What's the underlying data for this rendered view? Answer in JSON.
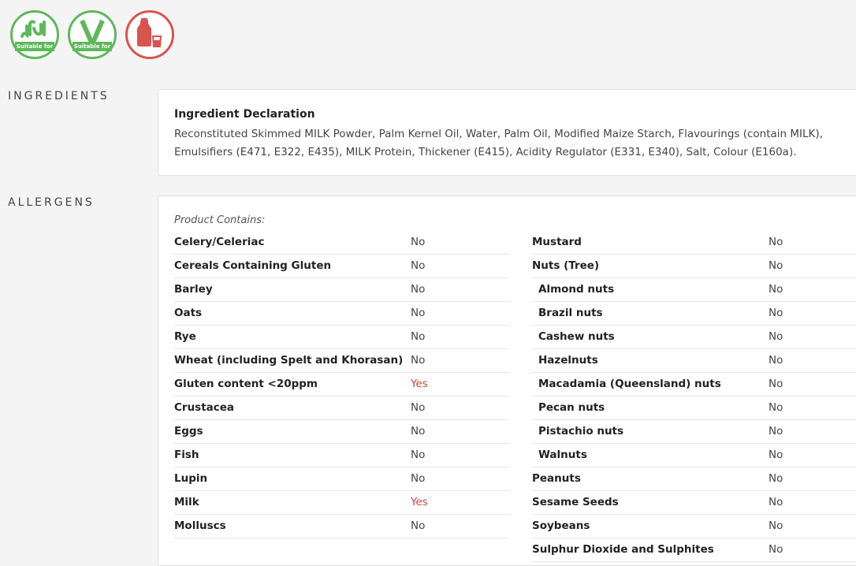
{
  "badges": [
    {
      "icon": "halal-icon",
      "text": "Suitable for",
      "color": "#5fb85a"
    },
    {
      "icon": "vegetarian-icon",
      "text": "Suitable for",
      "color": "#5fb85a"
    },
    {
      "icon": "milk-icon",
      "color": "#d9534f"
    }
  ],
  "ingredients": {
    "section_label": "INGREDIENTS",
    "title": "Ingredient Declaration",
    "text": "Reconstituted Skimmed MILK Powder, Palm Kernel Oil, Water, Palm Oil, Modified Maize Starch, Flavourings (contain MILK), Emulsifiers (E471, E322, E435), MILK Protein, Thickener (E415), Acidity Regulator (E331, E340), Salt, Colour (E160a)."
  },
  "allergens": {
    "section_label": "ALLERGENS",
    "contains_label": "Product Contains:",
    "left": [
      {
        "name": "Celery/Celeriac",
        "value": "No"
      },
      {
        "name": "Cereals Containing Gluten",
        "value": "No"
      },
      {
        "name": "Barley",
        "value": "No"
      },
      {
        "name": "Oats",
        "value": "No"
      },
      {
        "name": "Rye",
        "value": "No"
      },
      {
        "name": "Wheat (including Spelt and Khorasan)",
        "value": "No"
      },
      {
        "name": "Gluten content <20ppm",
        "value": "Yes"
      },
      {
        "name": "Crustacea",
        "value": "No"
      },
      {
        "name": "Eggs",
        "value": "No"
      },
      {
        "name": "Fish",
        "value": "No"
      },
      {
        "name": "Lupin",
        "value": "No"
      },
      {
        "name": "Milk",
        "value": "Yes"
      },
      {
        "name": "Molluscs",
        "value": "No"
      }
    ],
    "right": [
      {
        "name": "Mustard",
        "value": "No"
      },
      {
        "name": "Nuts (Tree)",
        "value": "No"
      },
      {
        "name": "Almond nuts",
        "value": "No",
        "sub": true
      },
      {
        "name": "Brazil nuts",
        "value": "No",
        "sub": true
      },
      {
        "name": "Cashew nuts",
        "value": "No",
        "sub": true
      },
      {
        "name": "Hazelnuts",
        "value": "No",
        "sub": true
      },
      {
        "name": "Macadamia (Queensland) nuts",
        "value": "No",
        "sub": true
      },
      {
        "name": "Pecan nuts",
        "value": "No",
        "sub": true
      },
      {
        "name": "Pistachio nuts",
        "value": "No",
        "sub": true
      },
      {
        "name": "Walnuts",
        "value": "No",
        "sub": true
      },
      {
        "name": "Peanuts",
        "value": "No"
      },
      {
        "name": "Sesame Seeds",
        "value": "No"
      },
      {
        "name": "Soybeans",
        "value": "No"
      },
      {
        "name": "Sulphur Dioxide and Sulphites",
        "value": "No"
      }
    ],
    "yes_color": "#c9463d"
  }
}
